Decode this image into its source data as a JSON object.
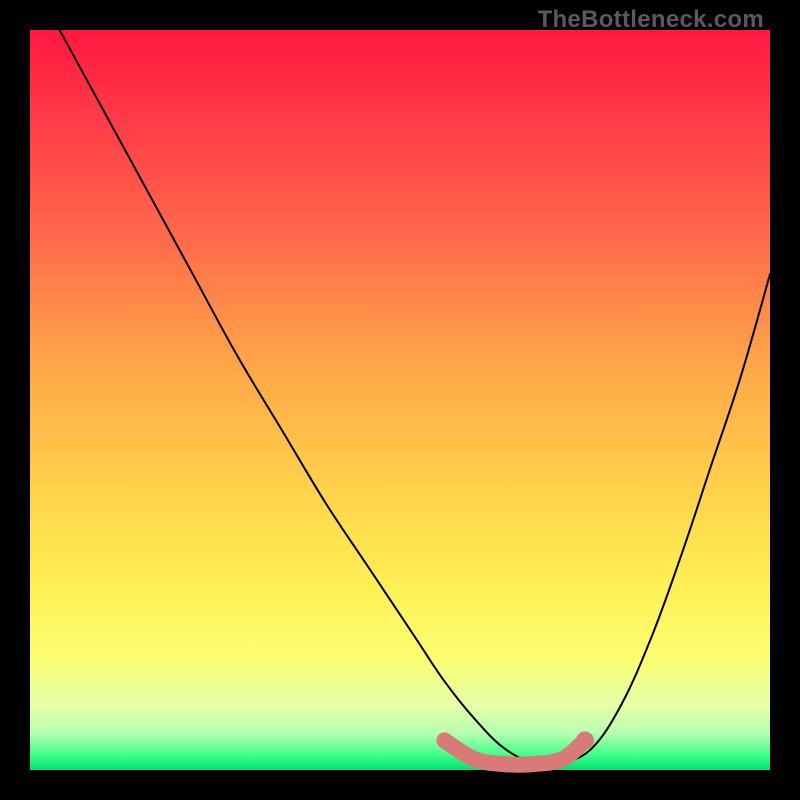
{
  "watermark": "TheBottleneck.com",
  "chart_data": {
    "type": "line",
    "title": "",
    "xlabel": "",
    "ylabel": "",
    "xlim": [
      0,
      100
    ],
    "ylim": [
      0,
      100
    ],
    "legend": false,
    "grid": false,
    "series": [
      {
        "name": "bottleneck-curve",
        "color": "#000000",
        "stroke_width": 2,
        "x": [
          4,
          10,
          16,
          22,
          28,
          34,
          40,
          46,
          52,
          56,
          60,
          64,
          68,
          72,
          76,
          80,
          84,
          88,
          92,
          96,
          100
        ],
        "y": [
          100,
          89,
          78,
          67,
          56,
          46,
          36,
          27,
          18,
          12,
          7,
          3,
          1,
          1,
          3,
          9,
          18,
          29,
          41,
          53,
          67
        ]
      },
      {
        "name": "highlight-band",
        "color": "#d97a78",
        "stroke_width": 16,
        "cap": "round",
        "x": [
          56,
          60,
          64,
          68,
          72,
          75
        ],
        "y": [
          4,
          1.5,
          0.8,
          0.8,
          1.5,
          4
        ]
      }
    ],
    "annotations": []
  }
}
